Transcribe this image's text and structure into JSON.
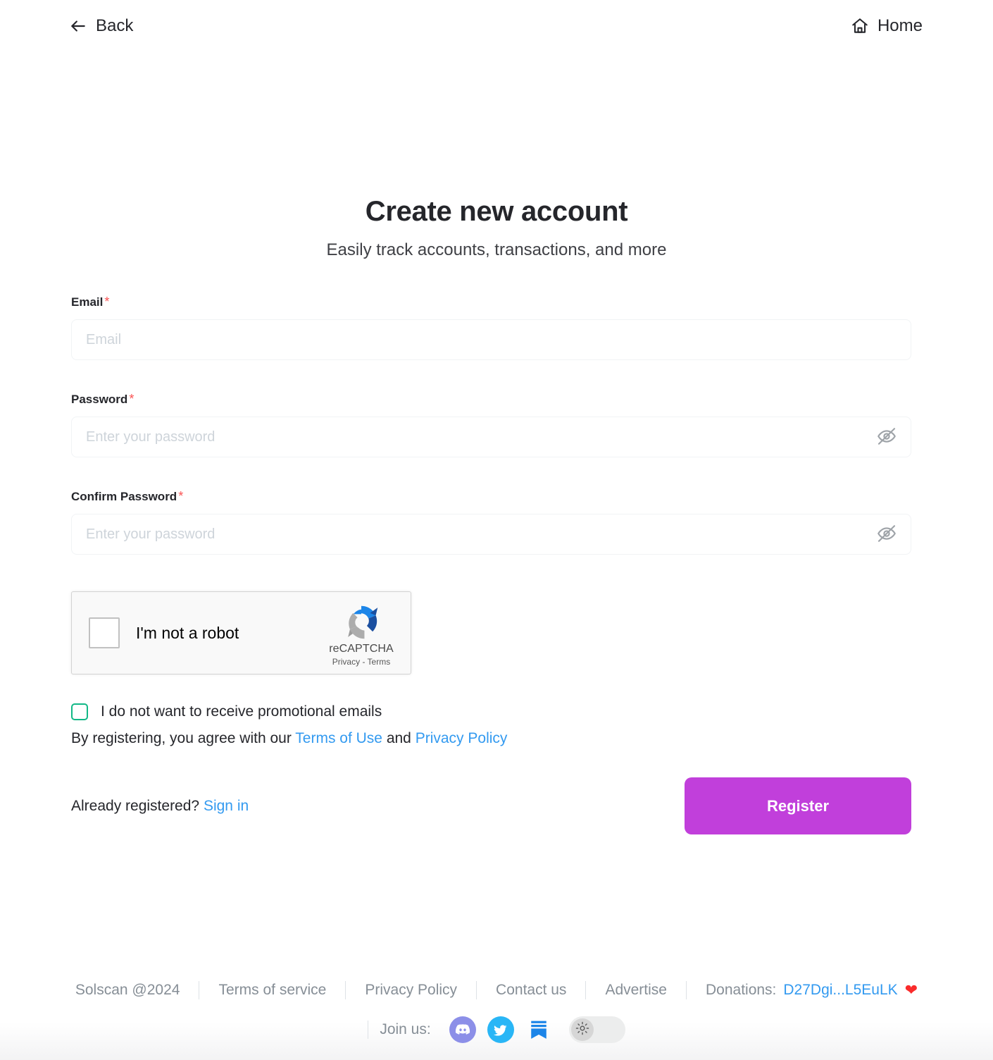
{
  "topbar": {
    "back_label": "Back",
    "back_icon": "arrow-left-icon",
    "home_label": "Home",
    "home_icon": "home-icon"
  },
  "header": {
    "title": "Create new account",
    "subtitle": "Easily track accounts, transactions, and more"
  },
  "form": {
    "required_marker": "*",
    "email": {
      "label": "Email",
      "placeholder": "Email",
      "value": ""
    },
    "password": {
      "label": "Password",
      "placeholder": "Enter your password",
      "value": "",
      "toggle_icon": "eye-off-icon"
    },
    "confirm_password": {
      "label": "Confirm Password",
      "placeholder": "Enter your password",
      "value": "",
      "toggle_icon": "eye-off-icon"
    }
  },
  "recaptcha": {
    "label": "I'm not a robot",
    "brand": "reCAPTCHA",
    "links": "Privacy - Terms",
    "checked": false
  },
  "promo": {
    "label": "I do not want to receive promotional emails",
    "checked": false,
    "accent_color": "#12b886"
  },
  "legal": {
    "prefix": "By registering, you agree with our ",
    "terms_link": "Terms of Use",
    "conjunction": " and ",
    "privacy_link": "Privacy Policy"
  },
  "actions": {
    "already_registered": "Already registered?",
    "sign_in_link": "Sign in",
    "register_label": "Register",
    "register_color": "#c13fdb"
  },
  "footer": {
    "copyright": "Solscan @2024",
    "links": [
      "Terms of service",
      "Privacy Policy",
      "Contact us",
      "Advertise"
    ],
    "donations_label": "Donations:",
    "donations_address": "D27Dgi...L5EuLK",
    "heart_icon": "heart-icon",
    "join_label": "Join us:",
    "socials": [
      "discord-icon",
      "twitter-icon",
      "substack-icon"
    ],
    "theme_toggle_icon": "sun-icon",
    "theme_mode": "light"
  },
  "colors": {
    "link": "#339af0",
    "required": "#fa5252",
    "heart": "#fa2b2b"
  }
}
